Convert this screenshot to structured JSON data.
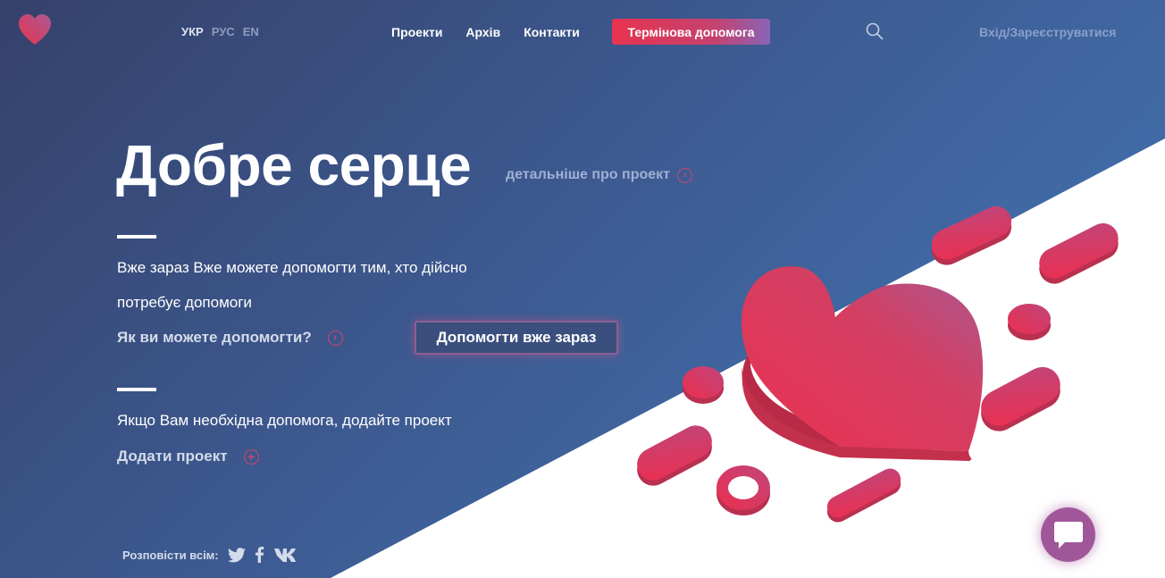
{
  "header": {
    "languages": [
      {
        "label": "УКР",
        "active": true
      },
      {
        "label": "РУС",
        "active": false
      },
      {
        "label": "EN",
        "active": false
      }
    ],
    "nav": [
      "Проекти",
      "Архів",
      "Контакти"
    ],
    "urgent_label": "Термінова допомога",
    "search_icon": "search-icon",
    "login_label": "Вхід/Зареєструватися"
  },
  "hero": {
    "title": "Добре серце",
    "more_label": "детальніше про проект",
    "text_line1": "Вже зараз Вже можете допомогти тим, хто дійсно",
    "text_line2": "потребує допомоги",
    "how_label": "Як ви можете допомогти?",
    "help_button": "Допомогти вже зараз",
    "need_text": "Якщо Вам необхідна допомога, додайте проект",
    "add_label": "Додати проект"
  },
  "share": {
    "label": "Розповісти всім:",
    "icons": [
      "twitter-icon",
      "facebook-icon",
      "vk-icon"
    ]
  },
  "colors": {
    "accent": "#e8334f",
    "gradient_start": "#35416b",
    "gradient_end": "#4479b8"
  }
}
